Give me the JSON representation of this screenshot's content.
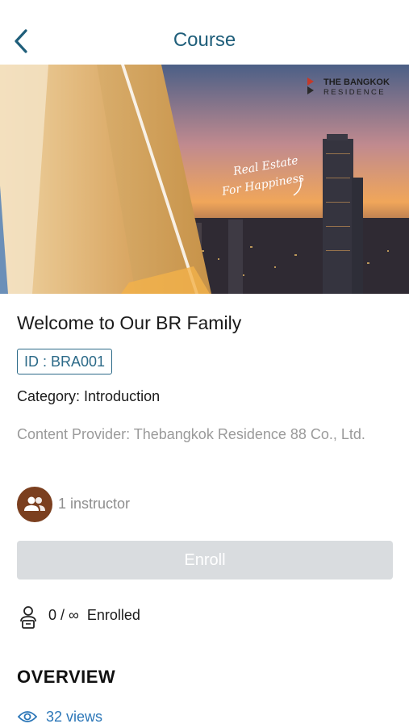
{
  "header": {
    "title": "Course",
    "back_icon": "chevron-left-icon"
  },
  "banner": {
    "brand_line1": "THE BANGKOK",
    "brand_line2": "RESIDENCE",
    "tagline_line1": "Real Estate",
    "tagline_line2": "For Happiness"
  },
  "course": {
    "title": "Welcome to Our BR Family",
    "id_label": "ID : BRA001",
    "category": "Category: Introduction",
    "provider": "Content Provider: Thebangkok Residence 88 Co., Ltd."
  },
  "instructor": {
    "label": "1 instructor",
    "avatar_color": "#7b3f1f",
    "icon": "people-icon"
  },
  "enroll": {
    "button_label": "Enroll",
    "status": "0 / ∞  Enrolled",
    "icon": "learner-icon"
  },
  "overview": {
    "heading": "OVERVIEW",
    "views": "32 views",
    "icon": "eye-icon"
  },
  "colors": {
    "accent": "#1f5e7a",
    "link": "#2c77b8",
    "disabled_button": "#d9dcdf"
  }
}
